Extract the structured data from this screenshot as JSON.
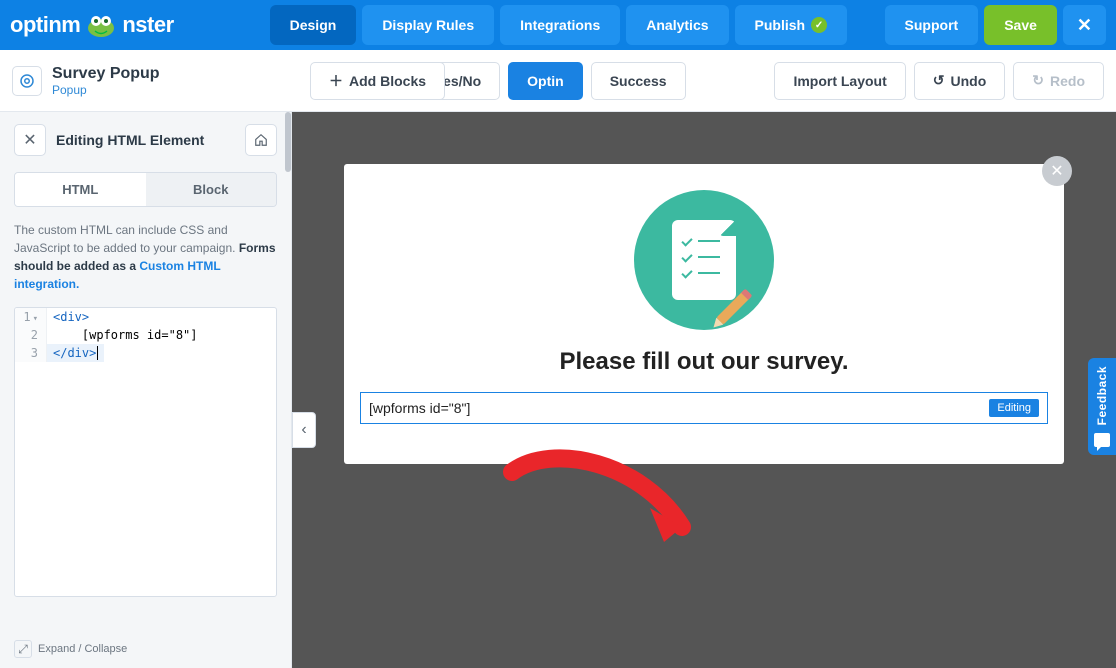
{
  "brand": {
    "name_left": "optinm",
    "name_right": "nster"
  },
  "nav": {
    "design": "Design",
    "display_rules": "Display Rules",
    "integrations": "Integrations",
    "analytics": "Analytics",
    "publish": "Publish",
    "support": "Support",
    "save": "Save"
  },
  "campaign": {
    "title": "Survey Popup",
    "type": "Popup"
  },
  "toolbar": {
    "add_blocks": "Add Blocks",
    "views": {
      "yesno": "Yes/No",
      "optin": "Optin",
      "success": "Success"
    },
    "import_layout": "Import Layout",
    "undo": "Undo",
    "redo": "Redo"
  },
  "sidebar": {
    "heading": "Editing HTML Element",
    "tabs": {
      "html": "HTML",
      "block": "Block"
    },
    "help_1": "The custom HTML can include CSS and JavaScript to be added to your campaign. ",
    "help_bold": "Forms should be added as a ",
    "help_link": "Custom HTML integration.",
    "code": {
      "l1_open": "div",
      "l2": "    [wpforms id=\"8\"]",
      "l3_close": "div"
    },
    "expand": "Expand / Collapse"
  },
  "popup": {
    "heading": "Please fill out our survey.",
    "html_content": "[wpforms id=\"8\"]",
    "editing_badge": "Editing"
  },
  "feedback": "Feedback"
}
